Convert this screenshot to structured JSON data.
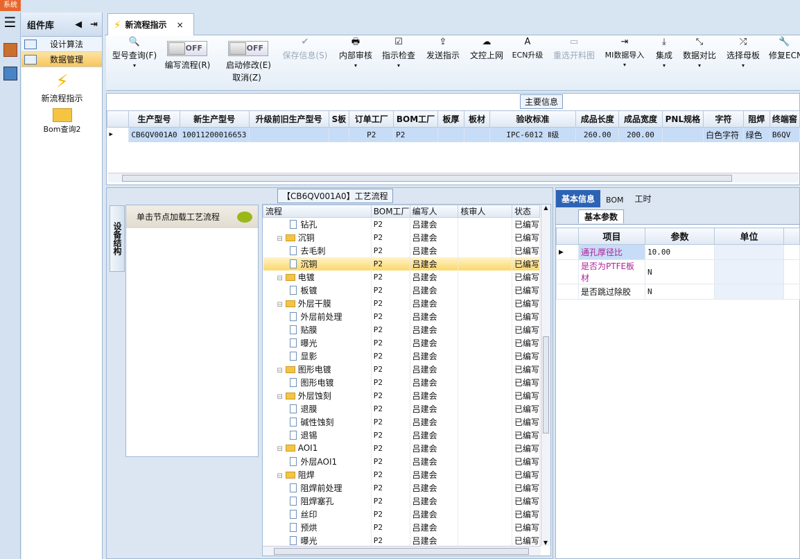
{
  "app": {
    "logo_text": "系统"
  },
  "components": {
    "title": "组件库",
    "menus": [
      {
        "label": "设计算法"
      },
      {
        "label": "数据管理"
      }
    ],
    "tools": [
      {
        "label": "新流程指示"
      },
      {
        "label": "Bom查询2"
      }
    ]
  },
  "tab": {
    "label": "新流程指示",
    "close": "×"
  },
  "toolbar": {
    "model_query": "型号查询(F)",
    "edit_flow": "编写流程(R)",
    "enable_edit": "启动修改(E)",
    "cancel": "取消(Z)",
    "off1": "OFF",
    "off2": "OFF",
    "buttons": [
      {
        "label": "保存信息(S)",
        "icon": "✔"
      },
      {
        "label": "内部审核",
        "icon": "🖶"
      },
      {
        "label": "指示检查",
        "icon": "☑"
      },
      {
        "label": "发送指示",
        "icon": "⇪"
      },
      {
        "label": "文控上网",
        "icon": "☁"
      },
      {
        "label": "ECN升级",
        "icon": "A"
      },
      {
        "label": "重选开料图",
        "icon": "▭"
      },
      {
        "label": "MI数据导入",
        "icon": "⇥"
      },
      {
        "label": "集成",
        "icon": "⤓"
      },
      {
        "label": "数据对比",
        "icon": "⤡"
      },
      {
        "label": "选择母板",
        "icon": "⤮"
      },
      {
        "label": "修复ECN",
        "icon": "🔧"
      }
    ]
  },
  "main_info": {
    "caption": "主要信息",
    "headers": [
      "生产型号",
      "新生产型号",
      "升级前旧生产型号",
      "S板",
      "订单工厂",
      "BOM工厂",
      "板厚",
      "板材",
      "验收标准",
      "成品长度",
      "成品宽度",
      "PNL规格",
      "字符",
      "阻焊",
      "终端窖"
    ],
    "row": [
      "CB6QV001A0",
      "10011200016653",
      "",
      "",
      "P2",
      "P2",
      "",
      "",
      "IPC-6012 Ⅱ级",
      "260.00",
      "200.00",
      "",
      "白色字符",
      "绿色",
      "B6QV"
    ]
  },
  "flow": {
    "caption": "【CB6QV001A0】工艺流程",
    "vtab": "设备结构",
    "node_hint": "单击节点加载工艺流程",
    "headers": [
      "流程",
      "BOM工厂",
      "编写人",
      "核审人",
      "状态"
    ],
    "rows": [
      {
        "n": "钻孔",
        "lvl": 2,
        "f": "P2",
        "w": "吕建会",
        "s": "已编写"
      },
      {
        "n": "沉铜",
        "lvl": 1,
        "f": "P2",
        "w": "吕建会",
        "s": "已编写"
      },
      {
        "n": "去毛刺",
        "lvl": 2,
        "f": "P2",
        "w": "吕建会",
        "s": "已编写"
      },
      {
        "n": "沉铜",
        "lvl": 2,
        "f": "P2",
        "w": "吕建会",
        "s": "已编写",
        "sel": true
      },
      {
        "n": "电镀",
        "lvl": 1,
        "f": "P2",
        "w": "吕建会",
        "s": "已编写"
      },
      {
        "n": "板镀",
        "lvl": 2,
        "f": "P2",
        "w": "吕建会",
        "s": "已编写"
      },
      {
        "n": "外层干膜",
        "lvl": 1,
        "f": "P2",
        "w": "吕建会",
        "s": "已编写"
      },
      {
        "n": "外层前处理",
        "lvl": 2,
        "f": "P2",
        "w": "吕建会",
        "s": "已编写"
      },
      {
        "n": "贴膜",
        "lvl": 2,
        "f": "P2",
        "w": "吕建会",
        "s": "已编写"
      },
      {
        "n": "曝光",
        "lvl": 2,
        "f": "P2",
        "w": "吕建会",
        "s": "已编写"
      },
      {
        "n": "显影",
        "lvl": 2,
        "f": "P2",
        "w": "吕建会",
        "s": "已编写"
      },
      {
        "n": "图形电镀",
        "lvl": 1,
        "f": "P2",
        "w": "吕建会",
        "s": "已编写"
      },
      {
        "n": "图形电镀",
        "lvl": 2,
        "f": "P2",
        "w": "吕建会",
        "s": "已编写"
      },
      {
        "n": "外层蚀刻",
        "lvl": 1,
        "f": "P2",
        "w": "吕建会",
        "s": "已编写"
      },
      {
        "n": "退膜",
        "lvl": 2,
        "f": "P2",
        "w": "吕建会",
        "s": "已编写"
      },
      {
        "n": "碱性蚀刻",
        "lvl": 2,
        "f": "P2",
        "w": "吕建会",
        "s": "已编写"
      },
      {
        "n": "退锡",
        "lvl": 2,
        "f": "P2",
        "w": "吕建会",
        "s": "已编写"
      },
      {
        "n": "AOI1",
        "lvl": 1,
        "f": "P2",
        "w": "吕建会",
        "s": "已编写"
      },
      {
        "n": "外层AOI1",
        "lvl": 2,
        "f": "P2",
        "w": "吕建会",
        "s": "已编写"
      },
      {
        "n": "阻焊",
        "lvl": 1,
        "f": "P2",
        "w": "吕建会",
        "s": "已编写"
      },
      {
        "n": "阻焊前处理",
        "lvl": 2,
        "f": "P2",
        "w": "吕建会",
        "s": "已编写"
      },
      {
        "n": "阻焊塞孔",
        "lvl": 2,
        "f": "P2",
        "w": "吕建会",
        "s": "已编写"
      },
      {
        "n": "丝印",
        "lvl": 2,
        "f": "P2",
        "w": "吕建会",
        "s": "已编写"
      },
      {
        "n": "预烘",
        "lvl": 2,
        "f": "P2",
        "w": "吕建会",
        "s": "已编写"
      },
      {
        "n": "曝光",
        "lvl": 2,
        "f": "P2",
        "w": "吕建会",
        "s": "已编写"
      }
    ]
  },
  "right": {
    "tabs": [
      "基本信息",
      "BOM",
      "工时"
    ],
    "subtab": "基本参数",
    "headers": [
      "项目",
      "参数",
      "单位"
    ],
    "rows": [
      {
        "item": "通孔厚径比",
        "val": "10.00",
        "unit": ""
      },
      {
        "item": "是否为PTFE板材",
        "val": "N",
        "unit": ""
      },
      {
        "item": "是否跳过除胶",
        "val": "N",
        "unit": ""
      }
    ]
  }
}
